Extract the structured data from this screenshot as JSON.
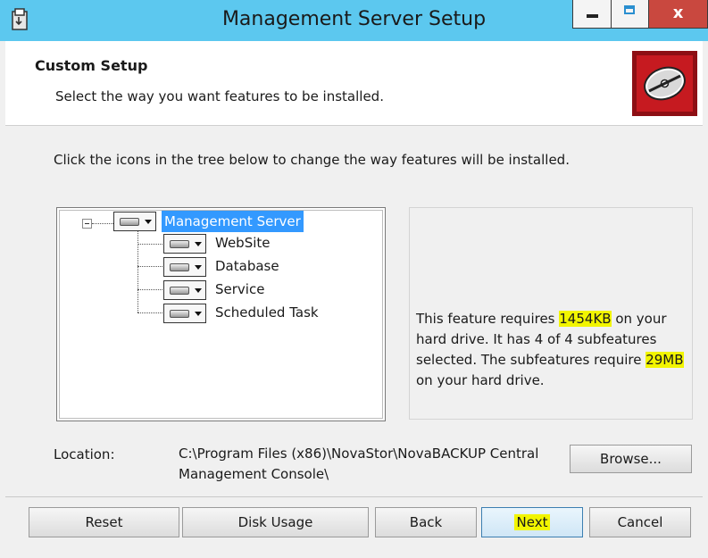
{
  "window": {
    "title": "Management Server Setup",
    "close_glyph": "x",
    "icon": "installer-icon"
  },
  "header": {
    "title": "Custom Setup",
    "subtitle": "Select the way you want features to be installed.",
    "logo_icon": "disc-logo-icon"
  },
  "instructions": "Click the icons in the tree below to change the way features will be installed.",
  "tree": {
    "root": {
      "label": "Management Server",
      "selected": true
    },
    "children": [
      {
        "label": "WebSite"
      },
      {
        "label": "Database"
      },
      {
        "label": "Service"
      },
      {
        "label": "Scheduled Task"
      }
    ]
  },
  "info": {
    "part1": "This feature requires ",
    "size1": "1454KB",
    "part2": " on your hard drive. It has 4 of 4 subfeatures selected. The subfeatures require ",
    "size2": "29MB",
    "part3": " on your hard drive."
  },
  "location": {
    "label": "Location:",
    "path": "C:\\Program Files (x86)\\NovaStor\\NovaBACKUP Central Management Console\\",
    "browse_label": "Browse..."
  },
  "buttons": {
    "reset": "Reset",
    "disk_usage": "Disk Usage",
    "back": "Back",
    "next": "Next",
    "cancel": "Cancel"
  },
  "colors": {
    "titlebar": "#5cc8ef",
    "close_button": "#c9483f",
    "selection": "#3399ff",
    "highlight": "#f2f500",
    "logo": "#c61a20"
  }
}
